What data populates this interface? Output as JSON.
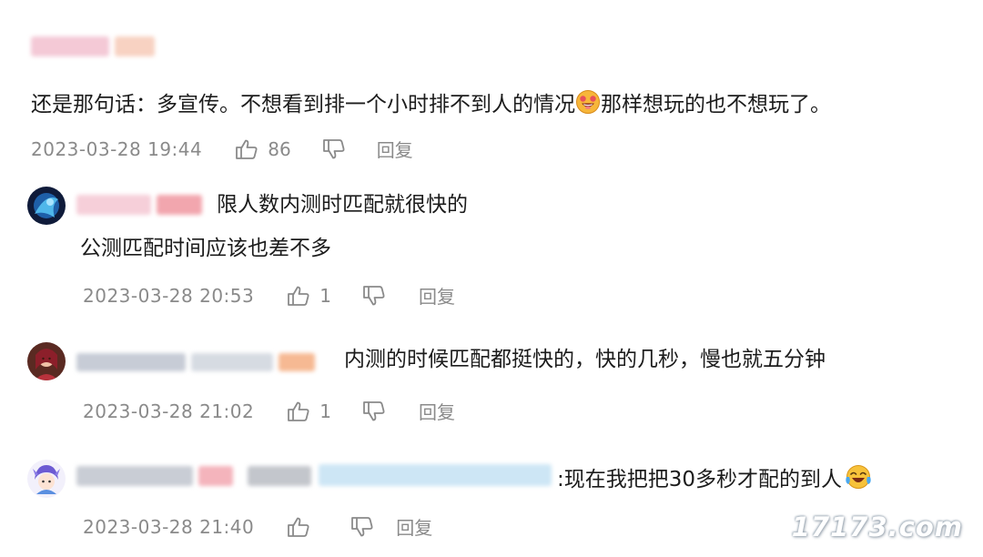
{
  "comments": [
    {
      "text": "还是那句话：多宣传。不想看到排一个小时排不到人的情况",
      "text_after": "那样想玩的也不想玩了。",
      "time": "2023-03-28 19:44",
      "likes": "86",
      "reply_label": "回复"
    }
  ],
  "replies": [
    {
      "line1": "限人数内测时匹配就很快的",
      "line2": "公测匹配时间应该也差不多",
      "time": "2023-03-28 20:53",
      "likes": "1",
      "reply_label": "回复"
    },
    {
      "line1": "内测的时候匹配都挺快的，快的几秒，慢也就五分钟",
      "time": "2023-03-28 21:02",
      "likes": "1",
      "reply_label": "回复"
    },
    {
      "line1": ":现在我把把30多秒才配的到人",
      "time": "2023-03-28 21:40",
      "reply_label": "回复"
    }
  ],
  "watermark": "17173.com",
  "icons": [
    "thumbs-up-icon",
    "thumbs-down-icon",
    "grinning-emoji-icon",
    "crying-laughing-emoji-icon"
  ]
}
